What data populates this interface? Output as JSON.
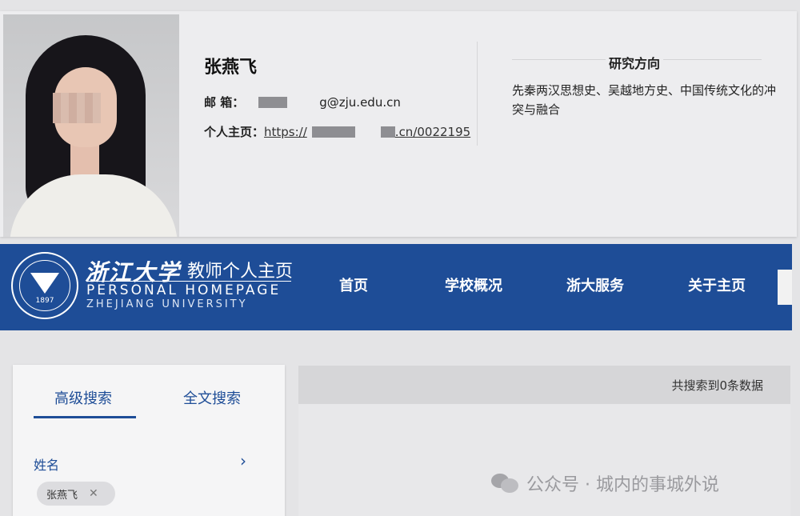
{
  "profile": {
    "name": "张燕飞",
    "email_label": "邮 箱：",
    "email_suffix": "g@zju.edu.cn",
    "homepage_label": "个人主页：",
    "homepage_prefix": "https://",
    "homepage_suffix": ".cn/0022195",
    "research_title": "研究方向",
    "research_text": "先秦两汉思想史、吴越地方史、中国传统文化的冲突与融合"
  },
  "header": {
    "logo_year": "1897",
    "logo_cn": "浙江大学",
    "logo_sub_cn": "教师个人主页",
    "logo_en_line1": "PERSONAL HOMEPAGE",
    "logo_en_line2": "ZHEJIANG UNIVERSITY",
    "nav": [
      "首页",
      "学校概况",
      "浙大服务",
      "关于主页"
    ],
    "accent_color": "#1e4d97"
  },
  "search": {
    "tabs": [
      "高级搜索",
      "全文搜索"
    ],
    "active_tab": 0,
    "field_label": "姓名",
    "chip_value": "张燕飞"
  },
  "results": {
    "count_text": "共搜索到0条数据"
  },
  "watermark": {
    "text": "公众号 · 城内的事城外说"
  }
}
